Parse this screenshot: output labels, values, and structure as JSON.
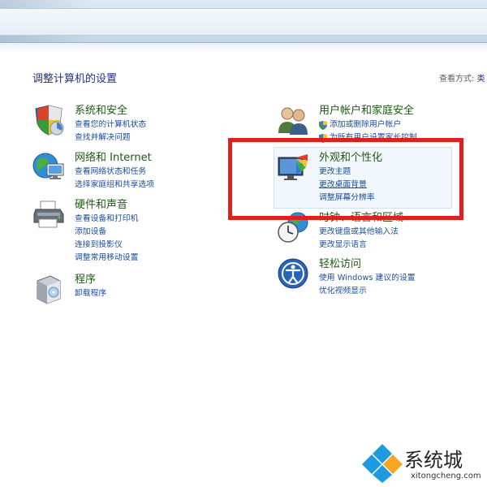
{
  "page": {
    "title": "调整计算机的设置",
    "view_by_label": "查看方式:",
    "view_by_value": "类"
  },
  "categories": {
    "system": {
      "title": "系统和安全",
      "icon": "shield-flag-icon",
      "links": [
        "查看您的计算机状态",
        "查找并解决问题"
      ]
    },
    "network": {
      "title": "网络和 Internet",
      "icon": "globe-network-icon",
      "links": [
        "查看网络状态和任务",
        "选择家庭组和共享选项"
      ]
    },
    "hardware": {
      "title": "硬件和声音",
      "icon": "printer-icon",
      "links": [
        "查看设备和打印机",
        "添加设备",
        "连接到投影仪",
        "调整常用移动设置"
      ]
    },
    "programs": {
      "title": "程序",
      "icon": "programs-box-icon",
      "links": [
        "卸载程序"
      ]
    },
    "users": {
      "title": "用户帐户和家庭安全",
      "icon": "users-icon",
      "links": [
        "添加或删除用户帐户",
        "为所有用户设置家长控制"
      ]
    },
    "appearance": {
      "title": "外观和个性化",
      "icon": "monitor-palette-icon",
      "links": [
        "更改主题",
        "更改桌面背景",
        "调整屏幕分辨率"
      ]
    },
    "clock": {
      "title": "时钟、语言和区域",
      "icon": "clock-globe-icon",
      "links": [
        "更改键盘或其他输入法",
        "更改显示语言"
      ]
    },
    "ease": {
      "title": "轻松访问",
      "icon": "ease-of-access-icon",
      "links": [
        "使用 Windows 建议的设置",
        "优化视频显示"
      ]
    }
  },
  "watermark": {
    "text": "系统城",
    "url": "xitongcheng.com"
  },
  "colors": {
    "heading_green": "#1e5a14",
    "link_blue": "#1a4c98",
    "title_navy": "#1e3287",
    "highlight_red": "#e0201c"
  }
}
